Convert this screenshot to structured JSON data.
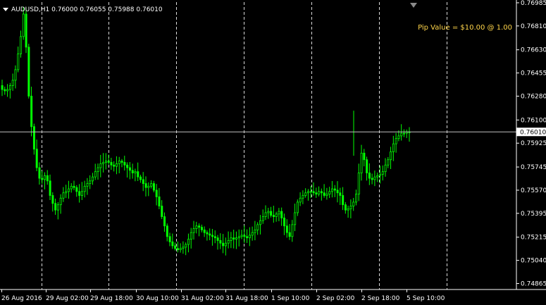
{
  "header": {
    "symbol": "AUDUSD,H1",
    "ohlc": "0.76000 0.76055 0.75988 0.76010"
  },
  "pip_info": "Pip Value = $10.00 @ 1.00",
  "current_price_label": "0.76010",
  "colors": {
    "background": "#000000",
    "candle": "#00ff00",
    "grid": "#ffffff",
    "axis": "#ffffff",
    "info_text": "#ffd54a",
    "price_line": "#c0c0c0"
  },
  "chart_data": {
    "type": "candlestick",
    "symbol": "AUDUSD",
    "timeframe": "H1",
    "grid": "vertical dashed",
    "ylim": [
      0.7482,
      0.7699
    ],
    "current_price": 0.7601,
    "y_ticks": [
      "0.76985",
      "0.76810",
      "0.76630",
      "0.76455",
      "0.76280",
      "0.76100",
      "0.75925",
      "0.75745",
      "0.75570",
      "0.75395",
      "0.75215",
      "0.75040",
      "0.74865"
    ],
    "x_ticks": [
      "26 Aug 2016",
      "29 Aug 02:00",
      "29 Aug 18:00",
      "30 Aug 10:00",
      "31 Aug 02:00",
      "31 Aug 18:00",
      "1 Sep 10:00",
      "2 Sep 02:00",
      "2 Sep 18:00",
      "5 Sep 10:00"
    ],
    "close_series": [
      0.7633,
      0.7632,
      0.7633,
      0.7636,
      0.764,
      0.7648,
      0.766,
      0.7673,
      0.769,
      0.7665,
      0.7628,
      0.7605,
      0.7588,
      0.7574,
      0.7566,
      0.7565,
      0.7568,
      0.7564,
      0.7553,
      0.7547,
      0.7542,
      0.7546,
      0.7551,
      0.7555,
      0.7556,
      0.7558,
      0.756,
      0.7559,
      0.7556,
      0.7553,
      0.7556,
      0.756,
      0.7562,
      0.7564,
      0.7567,
      0.7571,
      0.7574,
      0.7577,
      0.7578,
      0.7579,
      0.7578,
      0.7576,
      0.7575,
      0.7577,
      0.7579,
      0.7578,
      0.7576,
      0.7574,
      0.7572,
      0.757,
      0.7571,
      0.7567,
      0.7565,
      0.7562,
      0.7559,
      0.756,
      0.7562,
      0.7557,
      0.7552,
      0.7545,
      0.7537,
      0.753,
      0.7522,
      0.7518,
      0.7515,
      0.7513,
      0.7512,
      0.7513,
      0.7514,
      0.7516,
      0.752,
      0.7525,
      0.7528,
      0.753,
      0.7529,
      0.7527,
      0.7525,
      0.7524,
      0.7523,
      0.7522,
      0.7521,
      0.7519,
      0.7517,
      0.7515,
      0.7517,
      0.7519,
      0.7521,
      0.752,
      0.7521,
      0.7522,
      0.7523,
      0.7522,
      0.7521,
      0.7523,
      0.7525,
      0.7527,
      0.7531,
      0.7534,
      0.7537,
      0.754,
      0.7541,
      0.7538,
      0.7537,
      0.7539,
      0.7541,
      0.7536,
      0.753,
      0.7525,
      0.7522,
      0.7531,
      0.754,
      0.7548,
      0.7551,
      0.7553,
      0.7555,
      0.7556,
      0.7556,
      0.7555,
      0.7554,
      0.7556,
      0.7555,
      0.7553,
      0.7554,
      0.7556,
      0.7558,
      0.7557,
      0.7555,
      0.7553,
      0.7546,
      0.7542,
      0.7543,
      0.7545,
      0.7548,
      0.7554,
      0.757,
      0.7585,
      0.758,
      0.757,
      0.7566,
      0.7565,
      0.7567,
      0.7568,
      0.7569,
      0.7571,
      0.7576,
      0.758,
      0.7586,
      0.7592,
      0.7596,
      0.7598,
      0.76,
      0.76,
      0.7601,
      0.7601
    ]
  }
}
